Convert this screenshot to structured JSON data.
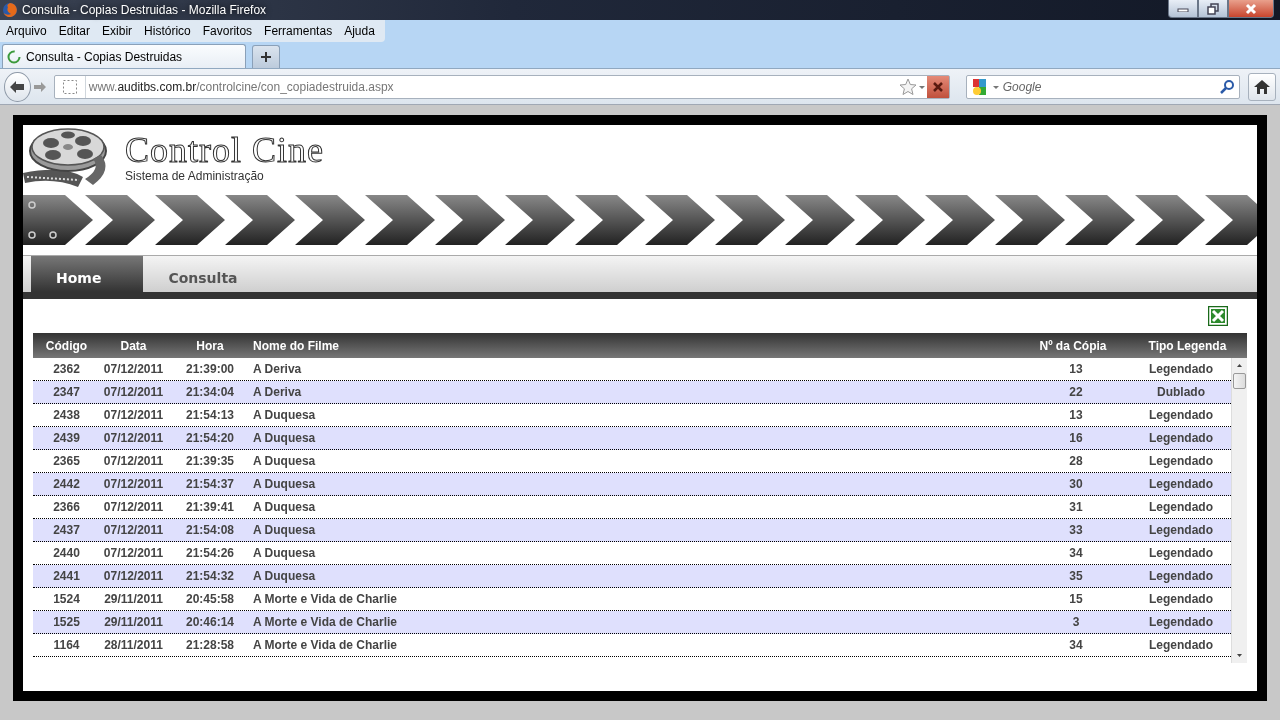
{
  "window": {
    "title": "Consulta - Copias Destruidas - Mozilla Firefox"
  },
  "menu": [
    "Arquivo",
    "Editar",
    "Exibir",
    "Histórico",
    "Favoritos",
    "Ferramentas",
    "Ajuda"
  ],
  "browser_tab": {
    "title": "Consulta - Copias Destruidas",
    "loading": true
  },
  "address_bar": {
    "url": "www.**auditbs.com.br**/controlcine/con_copiadestruida.aspx"
  },
  "search": {
    "placeholder": "Google"
  },
  "site": {
    "title": "Control Cine",
    "subtitle": "Sistema de Administração"
  },
  "nav_tabs": [
    {
      "label": "Home",
      "selected": true
    },
    {
      "label": "Consulta",
      "selected": false
    }
  ],
  "table": {
    "columns": [
      "Código",
      "Data",
      "Hora",
      "Nome do Filme",
      "Nº da Cópia",
      "Tipo Legenda"
    ],
    "rows": [
      [
        "2362",
        "07/12/2011",
        "21:39:00",
        "A Deriva",
        "13",
        "Legendado"
      ],
      [
        "2347",
        "07/12/2011",
        "21:34:04",
        "A Deriva",
        "22",
        "Dublado"
      ],
      [
        "2438",
        "07/12/2011",
        "21:54:13",
        "A Duquesa",
        "13",
        "Legendado"
      ],
      [
        "2439",
        "07/12/2011",
        "21:54:20",
        "A Duquesa",
        "16",
        "Legendado"
      ],
      [
        "2365",
        "07/12/2011",
        "21:39:35",
        "A Duquesa",
        "28",
        "Legendado"
      ],
      [
        "2442",
        "07/12/2011",
        "21:54:37",
        "A Duquesa",
        "30",
        "Legendado"
      ],
      [
        "2366",
        "07/12/2011",
        "21:39:41",
        "A Duquesa",
        "31",
        "Legendado"
      ],
      [
        "2437",
        "07/12/2011",
        "21:54:08",
        "A Duquesa",
        "33",
        "Legendado"
      ],
      [
        "2440",
        "07/12/2011",
        "21:54:26",
        "A Duquesa",
        "34",
        "Legendado"
      ],
      [
        "2441",
        "07/12/2011",
        "21:54:32",
        "A Duquesa",
        "35",
        "Legendado"
      ],
      [
        "1524",
        "29/11/2011",
        "20:45:58",
        "A Morte e Vida de Charlie",
        "15",
        "Legendado"
      ],
      [
        "1525",
        "29/11/2011",
        "20:46:14",
        "A Morte e Vida de Charlie",
        "3",
        "Legendado"
      ],
      [
        "1164",
        "28/11/2011",
        "21:28:58",
        "A Morte e Vida de Charlie",
        "34",
        "Legendado"
      ]
    ]
  }
}
